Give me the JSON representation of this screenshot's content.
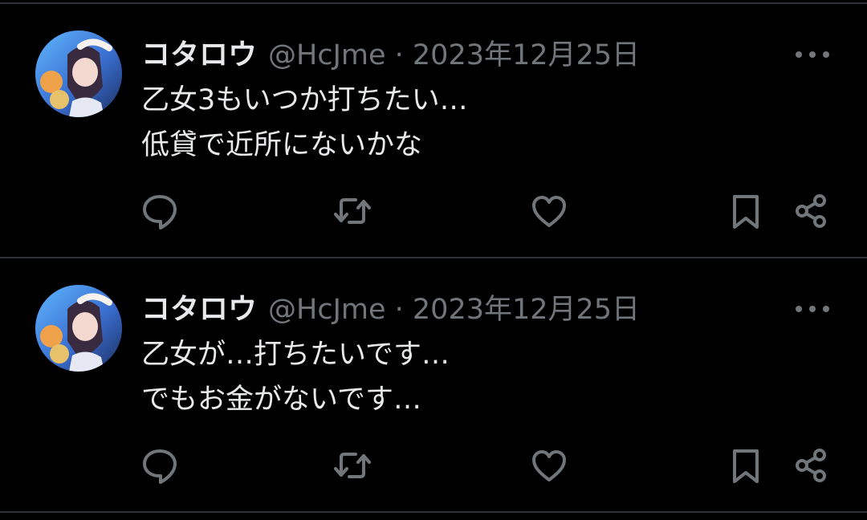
{
  "colors": {
    "background": "#000000",
    "text": "#e7e9ea",
    "secondary_text": "#71767b",
    "divider": "#2f3336"
  },
  "tweets": [
    {
      "display_name": "コタロウ",
      "meta": "@HcJme · 2023年12月25日",
      "lines": [
        "乙女3もいつか打ちたい…",
        "低貸で近所にないかな"
      ],
      "icons": [
        "reply-icon",
        "retweet-icon",
        "like-icon",
        "bookmark-icon",
        "share-icon",
        "more-icon"
      ]
    },
    {
      "display_name": "コタロウ",
      "meta": "@HcJme · 2023年12月25日",
      "lines": [
        "乙女が…打ちたいです…",
        "でもお金がないです…"
      ],
      "icons": [
        "reply-icon",
        "retweet-icon",
        "like-icon",
        "bookmark-icon",
        "share-icon",
        "more-icon"
      ]
    }
  ]
}
